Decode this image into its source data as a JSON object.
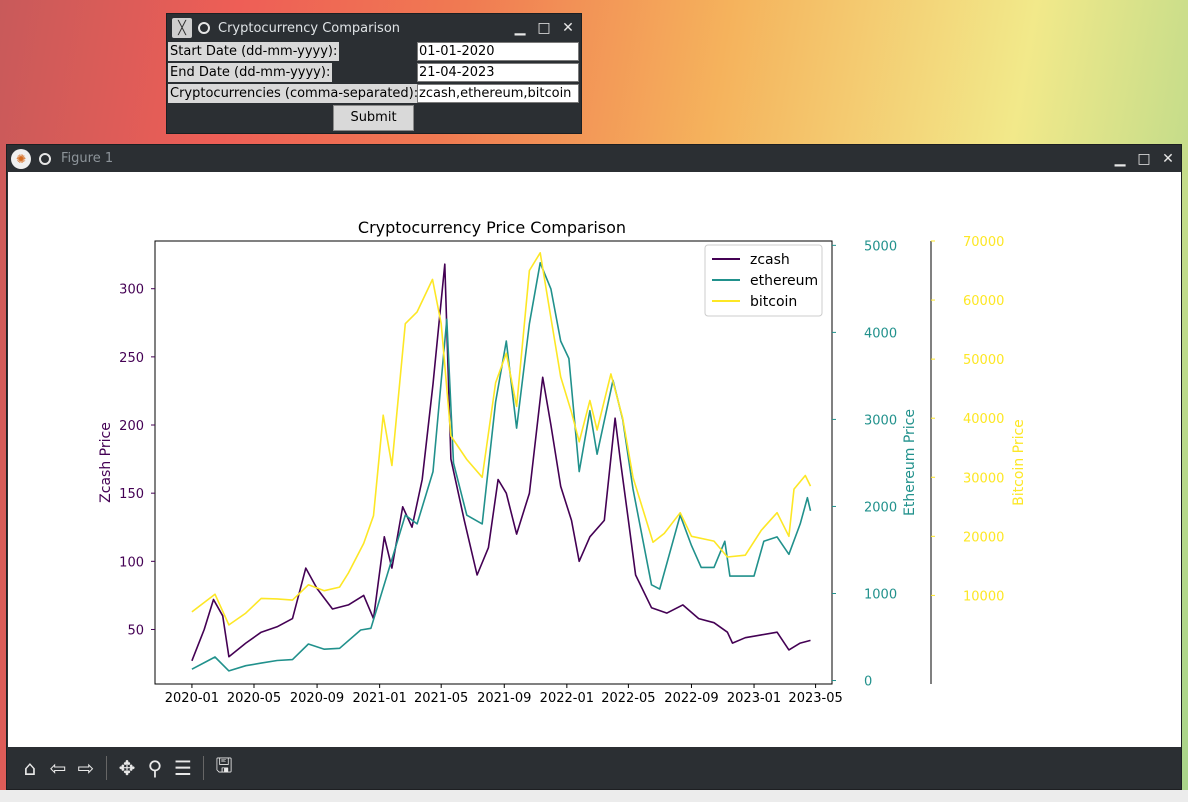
{
  "dialog": {
    "title": "Cryptocurrency Comparison",
    "start_label": "Start Date (dd-mm-yyyy):",
    "start_value": "01-01-2020",
    "end_label": "End Date (dd-mm-yyyy):",
    "end_value": "21-04-2023",
    "crypto_label": "Cryptocurrencies (comma-separated):",
    "crypto_value": "zcash,ethereum,bitcoin",
    "submit_label": "Submit"
  },
  "figure_window": {
    "title": "Figure 1",
    "toolbar_icons": [
      "home-icon",
      "back-icon",
      "forward-icon",
      "pan-icon",
      "zoom-icon",
      "configure-subplots-icon",
      "save-icon"
    ]
  },
  "chart_data": {
    "type": "line",
    "title": "Cryptocurrency Price Comparison",
    "xlabel": "",
    "x_ticks": [
      "2020-01",
      "2020-05",
      "2020-09",
      "2021-01",
      "2021-05",
      "2021-09",
      "2022-01",
      "2022-05",
      "2022-09",
      "2023-01",
      "2023-05"
    ],
    "x_range": [
      "2019-10-21",
      "2023-06-02"
    ],
    "axes": [
      {
        "name": "left",
        "label": "Zcash Price",
        "color": "#440154",
        "ylim": [
          10,
          335
        ],
        "ticks": [
          50,
          100,
          150,
          200,
          250,
          300
        ]
      },
      {
        "name": "right1",
        "label": "Ethereum Price",
        "color": "#21918c",
        "ylim": [
          -40,
          5050
        ],
        "ticks": [
          0,
          1000,
          2000,
          3000,
          4000,
          5000
        ]
      },
      {
        "name": "right2",
        "label": "Bitcoin Price",
        "color": "#fde725",
        "ylim": [
          -5000,
          70000
        ],
        "ticks": [
          10000,
          20000,
          30000,
          40000,
          50000,
          60000,
          70000
        ]
      }
    ],
    "legend": {
      "position": "top-right",
      "entries": [
        "zcash",
        "ethereum",
        "bitcoin"
      ]
    },
    "series": [
      {
        "name": "zcash",
        "axis": "left",
        "color": "#440154",
        "points": [
          [
            "2020-01-01",
            27
          ],
          [
            "2020-01-25",
            50
          ],
          [
            "2020-02-12",
            72
          ],
          [
            "2020-03-01",
            60
          ],
          [
            "2020-03-13",
            30
          ],
          [
            "2020-04-15",
            40
          ],
          [
            "2020-05-15",
            48
          ],
          [
            "2020-06-15",
            52
          ],
          [
            "2020-07-15",
            58
          ],
          [
            "2020-08-10",
            95
          ],
          [
            "2020-09-01",
            80
          ],
          [
            "2020-10-01",
            65
          ],
          [
            "2020-11-01",
            68
          ],
          [
            "2020-12-01",
            75
          ],
          [
            "2020-12-20",
            58
          ],
          [
            "2021-01-10",
            118
          ],
          [
            "2021-01-25",
            95
          ],
          [
            "2021-02-15",
            140
          ],
          [
            "2021-03-05",
            125
          ],
          [
            "2021-03-25",
            160
          ],
          [
            "2021-04-15",
            230
          ],
          [
            "2021-05-08",
            318
          ],
          [
            "2021-05-20",
            175
          ],
          [
            "2021-06-15",
            130
          ],
          [
            "2021-07-10",
            90
          ],
          [
            "2021-08-01",
            110
          ],
          [
            "2021-08-20",
            160
          ],
          [
            "2021-09-05",
            150
          ],
          [
            "2021-09-25",
            120
          ],
          [
            "2021-10-20",
            150
          ],
          [
            "2021-11-15",
            235
          ],
          [
            "2021-12-01",
            200
          ],
          [
            "2021-12-20",
            155
          ],
          [
            "2022-01-10",
            130
          ],
          [
            "2022-01-25",
            100
          ],
          [
            "2022-02-15",
            118
          ],
          [
            "2022-03-15",
            130
          ],
          [
            "2022-04-05",
            205
          ],
          [
            "2022-04-15",
            175
          ],
          [
            "2022-05-01",
            130
          ],
          [
            "2022-05-15",
            90
          ],
          [
            "2022-06-15",
            66
          ],
          [
            "2022-07-15",
            62
          ],
          [
            "2022-08-15",
            68
          ],
          [
            "2022-09-15",
            58
          ],
          [
            "2022-10-15",
            55
          ],
          [
            "2022-11-10",
            48
          ],
          [
            "2022-11-20",
            40
          ],
          [
            "2022-12-15",
            44
          ],
          [
            "2023-01-15",
            46
          ],
          [
            "2023-02-15",
            48
          ],
          [
            "2023-03-10",
            35
          ],
          [
            "2023-04-01",
            40
          ],
          [
            "2023-04-21",
            42
          ]
        ]
      },
      {
        "name": "ethereum",
        "axis": "right1",
        "color": "#21918c",
        "points": [
          [
            "2020-01-01",
            130
          ],
          [
            "2020-02-15",
            270
          ],
          [
            "2020-03-13",
            110
          ],
          [
            "2020-04-15",
            170
          ],
          [
            "2020-05-15",
            200
          ],
          [
            "2020-06-15",
            230
          ],
          [
            "2020-07-15",
            240
          ],
          [
            "2020-08-15",
            420
          ],
          [
            "2020-09-15",
            360
          ],
          [
            "2020-10-15",
            370
          ],
          [
            "2020-11-25",
            580
          ],
          [
            "2020-12-15",
            600
          ],
          [
            "2021-01-15",
            1200
          ],
          [
            "2021-02-20",
            1900
          ],
          [
            "2021-03-15",
            1800
          ],
          [
            "2021-04-15",
            2400
          ],
          [
            "2021-05-12",
            4150
          ],
          [
            "2021-05-25",
            2500
          ],
          [
            "2021-06-20",
            1900
          ],
          [
            "2021-07-20",
            1800
          ],
          [
            "2021-08-15",
            3200
          ],
          [
            "2021-09-05",
            3900
          ],
          [
            "2021-09-25",
            2900
          ],
          [
            "2021-10-20",
            4100
          ],
          [
            "2021-11-10",
            4800
          ],
          [
            "2021-12-01",
            4500
          ],
          [
            "2021-12-20",
            3900
          ],
          [
            "2022-01-05",
            3700
          ],
          [
            "2022-01-25",
            2400
          ],
          [
            "2022-02-15",
            3100
          ],
          [
            "2022-03-01",
            2600
          ],
          [
            "2022-04-01",
            3450
          ],
          [
            "2022-04-20",
            3000
          ],
          [
            "2022-05-10",
            2200
          ],
          [
            "2022-06-15",
            1100
          ],
          [
            "2022-07-01",
            1050
          ],
          [
            "2022-08-10",
            1900
          ],
          [
            "2022-09-01",
            1550
          ],
          [
            "2022-09-20",
            1300
          ],
          [
            "2022-10-15",
            1300
          ],
          [
            "2022-11-05",
            1600
          ],
          [
            "2022-11-15",
            1200
          ],
          [
            "2022-12-15",
            1200
          ],
          [
            "2023-01-01",
            1200
          ],
          [
            "2023-01-20",
            1600
          ],
          [
            "2023-02-15",
            1650
          ],
          [
            "2023-03-10",
            1450
          ],
          [
            "2023-04-01",
            1800
          ],
          [
            "2023-04-15",
            2100
          ],
          [
            "2023-04-21",
            1950
          ]
        ]
      },
      {
        "name": "bitcoin",
        "axis": "right2",
        "color": "#fde725",
        "points": [
          [
            "2020-01-01",
            7200
          ],
          [
            "2020-02-15",
            10200
          ],
          [
            "2020-03-13",
            5000
          ],
          [
            "2020-04-15",
            7000
          ],
          [
            "2020-05-15",
            9500
          ],
          [
            "2020-06-15",
            9400
          ],
          [
            "2020-07-15",
            9200
          ],
          [
            "2020-08-15",
            11800
          ],
          [
            "2020-09-15",
            10800
          ],
          [
            "2020-10-15",
            11400
          ],
          [
            "2020-11-01",
            13800
          ],
          [
            "2020-12-01",
            18800
          ],
          [
            "2020-12-20",
            23500
          ],
          [
            "2021-01-08",
            40500
          ],
          [
            "2021-01-25",
            32000
          ],
          [
            "2021-02-20",
            56000
          ],
          [
            "2021-03-15",
            58000
          ],
          [
            "2021-04-14",
            63500
          ],
          [
            "2021-05-01",
            56000
          ],
          [
            "2021-05-20",
            37000
          ],
          [
            "2021-06-20",
            33000
          ],
          [
            "2021-07-20",
            30000
          ],
          [
            "2021-08-15",
            46000
          ],
          [
            "2021-09-05",
            51000
          ],
          [
            "2021-09-25",
            42000
          ],
          [
            "2021-10-20",
            65000
          ],
          [
            "2021-11-10",
            68000
          ],
          [
            "2021-12-01",
            57000
          ],
          [
            "2021-12-20",
            47000
          ],
          [
            "2022-01-10",
            41000
          ],
          [
            "2022-01-25",
            36000
          ],
          [
            "2022-02-15",
            43000
          ],
          [
            "2022-03-01",
            38000
          ],
          [
            "2022-03-28",
            47500
          ],
          [
            "2022-04-20",
            40000
          ],
          [
            "2022-05-10",
            30000
          ],
          [
            "2022-06-18",
            19000
          ],
          [
            "2022-07-10",
            20500
          ],
          [
            "2022-08-10",
            24000
          ],
          [
            "2022-09-01",
            20000
          ],
          [
            "2022-10-15",
            19200
          ],
          [
            "2022-11-10",
            16500
          ],
          [
            "2022-12-15",
            16800
          ],
          [
            "2023-01-15",
            21000
          ],
          [
            "2023-02-15",
            24000
          ],
          [
            "2023-03-10",
            20000
          ],
          [
            "2023-03-20",
            28000
          ],
          [
            "2023-04-11",
            30300
          ],
          [
            "2023-04-21",
            28500
          ]
        ]
      }
    ]
  }
}
